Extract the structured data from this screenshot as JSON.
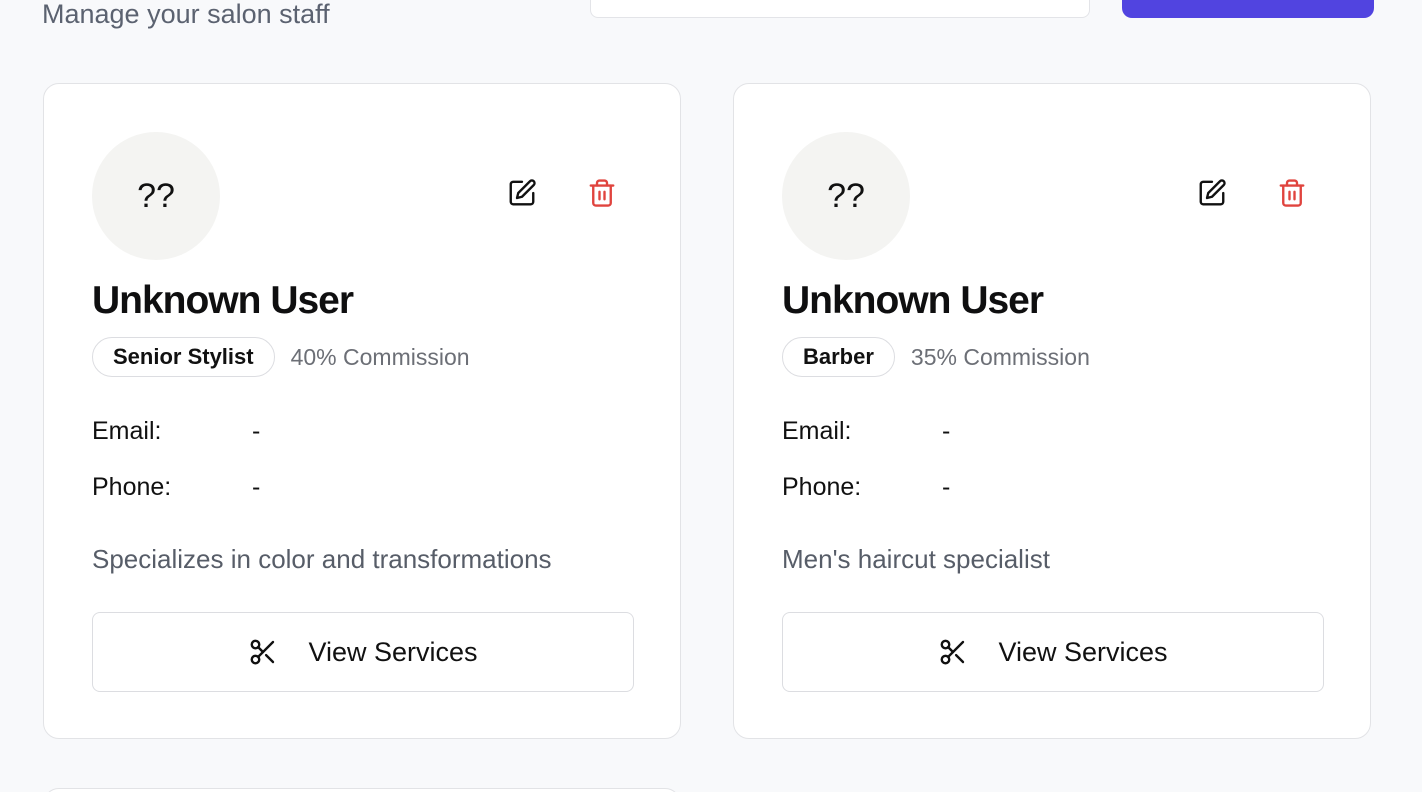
{
  "header": {
    "subtitle": "Manage your salon staff"
  },
  "colors": {
    "primary": "#5144e0",
    "danger": "#e0443e",
    "muted_text": "#6c6f76",
    "avatar_bg": "#f4f4f2"
  },
  "staff": [
    {
      "initials": "??",
      "name": "Unknown User",
      "role": "Senior Stylist",
      "commission": "40% Commission",
      "email_label": "Email:",
      "email": "-",
      "phone_label": "Phone:",
      "phone": "-",
      "description": "Specializes in color and transformations",
      "services_label": "View Services",
      "icons": {
        "edit": "edit-icon",
        "delete": "trash-icon",
        "services": "scissors-icon"
      }
    },
    {
      "initials": "??",
      "name": "Unknown User",
      "role": "Barber",
      "commission": "35% Commission",
      "email_label": "Email:",
      "email": "-",
      "phone_label": "Phone:",
      "phone": "-",
      "description": "Men's haircut specialist",
      "services_label": "View Services",
      "icons": {
        "edit": "edit-icon",
        "delete": "trash-icon",
        "services": "scissors-icon"
      }
    }
  ]
}
